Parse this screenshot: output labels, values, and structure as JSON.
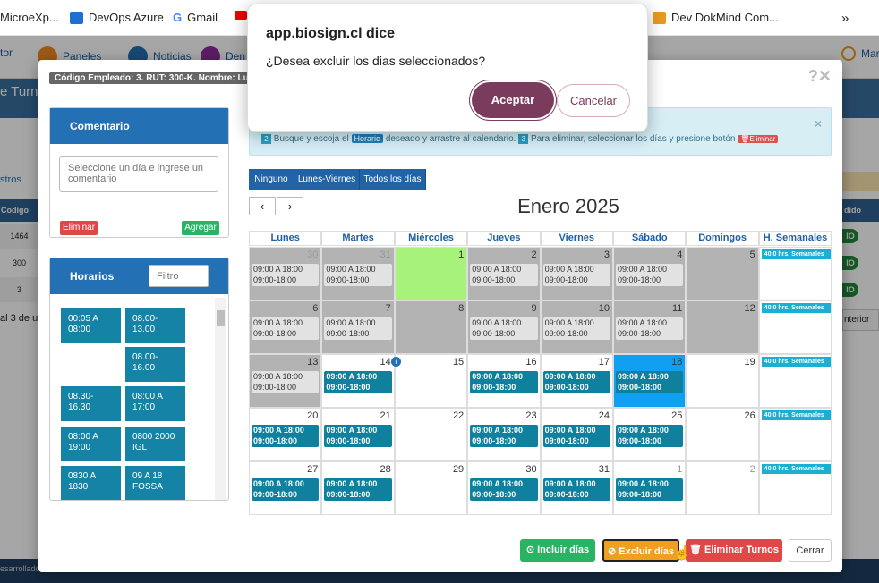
{
  "browser": {
    "bookmarks": [
      {
        "label": "MicroeXp...",
        "icon": "folder-icon"
      },
      {
        "label": "DevOps Azure",
        "icon": "azure-devops-icon"
      },
      {
        "label": "Gmail",
        "icon": "google-icon"
      },
      {
        "label": "Dev DokMind Com...",
        "icon": "dokmind-icon"
      }
    ],
    "more": "»"
  },
  "app_nav": {
    "left": "tor",
    "paneles": "Paneles",
    "noticias": "Noticias",
    "den": "Den",
    "right": "Marc"
  },
  "background": {
    "title": "e Turnos",
    "tab": "stros",
    "col_code": "Codigo",
    "rows": [
      "1464",
      "300",
      "3"
    ],
    "footer_count": "al 3 de u",
    "col_status": "dido",
    "status_badge": "IO",
    "anterior": "nterior",
    "developed": "esarrollado"
  },
  "modal": {
    "employee": "Código Empleado: 3. RUT: 300-K. Nombre: Lu",
    "comentario": {
      "title": "Comentario",
      "placeholder": "Seleccione un día e ingrese un comentario",
      "delete": "Eliminar",
      "add": "Agregar"
    },
    "horarios": {
      "title": "Horarios",
      "filter_placeholder": "Filtro",
      "items": [
        "00:05 A 08:00",
        "08.00-13.00",
        "08.00-16.00",
        "08.30-16.30",
        "08:00 A 17:00",
        "08:00 A 19:00",
        "0800 2000 IGL",
        "0830 A 1830",
        "09 A 18 FOSSA"
      ]
    },
    "info": {
      "step2_num": "2",
      "step2_a": "Busque y escoja el",
      "horario_tag": "Horario",
      "step2_b": "deseado y arrastre al calendario.",
      "step3_num": "3",
      "step3": "Para eliminar, seleccionar los días y presione botón",
      "eliminar_tag": "Eliminar"
    },
    "filters": [
      "Ninguno",
      "Lunes-Viernes",
      "Todos los días"
    ],
    "prev": "‹",
    "next": "›",
    "month": "Enero 2025",
    "weekdays": [
      "Lunes",
      "Martes",
      "Miércoles",
      "Jueves",
      "Viernes",
      "Sábado",
      "Domingos",
      "H. Semanales"
    ],
    "weekly_hours": "40.0 hrs. Semanales",
    "weeks": [
      [
        {
          "n": "30",
          "state": "gray",
          "faded": true,
          "ev": [
            "09:00 A 18:00",
            "09:00-18:00"
          ],
          "evtype": "gray"
        },
        {
          "n": "31",
          "state": "gray",
          "faded": true,
          "ev": [
            "09:00 A 18:00",
            "09:00-18:00"
          ],
          "evtype": "gray"
        },
        {
          "n": "1",
          "state": "green",
          "faded": false,
          "ev": [],
          "evtype": ""
        },
        {
          "n": "2",
          "state": "gray",
          "faded": false,
          "ev": [
            "09:00 A 18:00",
            "09:00-18:00"
          ],
          "evtype": "gray"
        },
        {
          "n": "3",
          "state": "gray",
          "faded": false,
          "ev": [
            "09:00 A 18:00",
            "09:00-18:00"
          ],
          "evtype": "gray"
        },
        {
          "n": "4",
          "state": "gray",
          "faded": false,
          "ev": [
            "09:00 A 18:00",
            "09:00-18:00"
          ],
          "evtype": "gray"
        },
        {
          "n": "5",
          "state": "gray",
          "faded": false,
          "ev": [],
          "evtype": ""
        }
      ],
      [
        {
          "n": "6",
          "state": "gray",
          "faded": false,
          "ev": [
            "09:00 A 18:00",
            "09:00-18:00"
          ],
          "evtype": "gray"
        },
        {
          "n": "7",
          "state": "gray",
          "faded": false,
          "ev": [
            "09:00 A 18:00",
            "09:00-18:00"
          ],
          "evtype": "gray"
        },
        {
          "n": "8",
          "state": "gray",
          "faded": false,
          "ev": [],
          "evtype": ""
        },
        {
          "n": "9",
          "state": "gray",
          "faded": false,
          "ev": [
            "09:00 A 18:00",
            "09:00-18:00"
          ],
          "evtype": "gray"
        },
        {
          "n": "10",
          "state": "gray",
          "faded": false,
          "ev": [
            "09:00 A 18:00",
            "09:00-18:00"
          ],
          "evtype": "gray"
        },
        {
          "n": "11",
          "state": "gray",
          "faded": false,
          "ev": [
            "09:00 A 18:00",
            "09:00-18:00"
          ],
          "evtype": "gray"
        },
        {
          "n": "12",
          "state": "gray",
          "faded": false,
          "ev": [],
          "evtype": ""
        }
      ],
      [
        {
          "n": "13",
          "state": "gray",
          "faded": false,
          "ev": [
            "09:00 A 18:00",
            "09:00-18:00"
          ],
          "evtype": "gray"
        },
        {
          "n": "14",
          "state": "white",
          "faded": false,
          "ev": [
            "09:00 A 18:00",
            "09:00-18:00"
          ],
          "evtype": "teal",
          "infoicon": true
        },
        {
          "n": "15",
          "state": "white",
          "faded": false,
          "ev": [],
          "evtype": ""
        },
        {
          "n": "16",
          "state": "white",
          "faded": false,
          "ev": [
            "09:00 A 18:00",
            "09:00-18:00"
          ],
          "evtype": "teal"
        },
        {
          "n": "17",
          "state": "white",
          "faded": false,
          "ev": [
            "09:00 A 18:00",
            "09:00-18:00"
          ],
          "evtype": "teal"
        },
        {
          "n": "18",
          "state": "blue",
          "faded": false,
          "ev": [
            "09:00 A 18:00",
            "09:00-18:00"
          ],
          "evtype": "teal"
        },
        {
          "n": "19",
          "state": "white",
          "faded": false,
          "ev": [],
          "evtype": ""
        }
      ],
      [
        {
          "n": "20",
          "state": "white",
          "faded": false,
          "ev": [
            "09:00 A 18:00",
            "09:00-18:00"
          ],
          "evtype": "teal"
        },
        {
          "n": "21",
          "state": "white",
          "faded": false,
          "ev": [
            "09:00 A 18:00",
            "09:00-18:00"
          ],
          "evtype": "teal"
        },
        {
          "n": "22",
          "state": "white",
          "faded": false,
          "ev": [],
          "evtype": ""
        },
        {
          "n": "23",
          "state": "white",
          "faded": false,
          "ev": [
            "09:00 A 18:00",
            "09:00-18:00"
          ],
          "evtype": "teal"
        },
        {
          "n": "24",
          "state": "white",
          "faded": false,
          "ev": [
            "09:00 A 18:00",
            "09:00-18:00"
          ],
          "evtype": "teal"
        },
        {
          "n": "25",
          "state": "white",
          "faded": false,
          "ev": [
            "09:00 A 18:00",
            "09:00-18:00"
          ],
          "evtype": "teal"
        },
        {
          "n": "26",
          "state": "white",
          "faded": false,
          "ev": [],
          "evtype": ""
        }
      ],
      [
        {
          "n": "27",
          "state": "white",
          "faded": false,
          "ev": [
            "09:00 A 18:00",
            "09:00-18:00"
          ],
          "evtype": "teal"
        },
        {
          "n": "28",
          "state": "white",
          "faded": false,
          "ev": [
            "09:00 A 18:00",
            "09:00-18:00"
          ],
          "evtype": "teal"
        },
        {
          "n": "29",
          "state": "white",
          "faded": false,
          "ev": [],
          "evtype": ""
        },
        {
          "n": "30",
          "state": "white",
          "faded": false,
          "ev": [
            "09:00 A 18:00",
            "09:00-18:00"
          ],
          "evtype": "teal"
        },
        {
          "n": "31",
          "state": "white",
          "faded": false,
          "ev": [
            "09:00 A 18:00",
            "09:00-18:00"
          ],
          "evtype": "teal"
        },
        {
          "n": "1",
          "state": "white",
          "faded": true,
          "ev": [
            "09:00 A 18:00",
            "09:00-18:00"
          ],
          "evtype": "teal"
        },
        {
          "n": "2",
          "state": "white",
          "faded": true,
          "ev": [],
          "evtype": ""
        }
      ]
    ],
    "footer": {
      "incluir": "Incluir días",
      "excluir": "Excluir días",
      "eliminar": "Eliminar Turnos",
      "cerrar": "Cerrar"
    }
  },
  "alert": {
    "title": "app.biosign.cl dice",
    "message": "¿Desea excluir los dias seleccionados?",
    "accept": "Aceptar",
    "cancel": "Cancelar"
  },
  "colors": {
    "primary": "#2470b4",
    "teal": "#10809f",
    "gray_day": "#b3b3b3",
    "green_day": "#a6f27a",
    "selected_day": "#0fa0f2",
    "success": "#28b463",
    "warning": "#f0a020",
    "danger": "#e04848",
    "dialog_accent": "#7b3b5c"
  }
}
